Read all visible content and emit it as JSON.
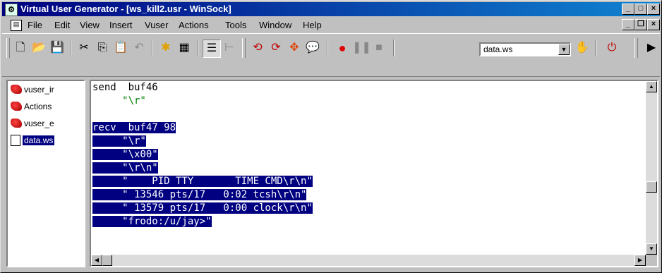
{
  "window": {
    "title": "Virtual User Generator - [ws_kill2.usr - WinSock]"
  },
  "menu": [
    "File",
    "Edit",
    "View",
    "Insert",
    "Vuser",
    "Actions",
    "Tools",
    "Window",
    "Help"
  ],
  "toolbar": {
    "combo_value": "data.ws"
  },
  "tree": [
    {
      "label": "vuser_ir",
      "icon": "red-action-icon"
    },
    {
      "label": "Actions",
      "icon": "red-action-icon"
    },
    {
      "label": "vuser_e",
      "icon": "red-action-icon"
    },
    {
      "label": "data.ws",
      "icon": "data-file-icon",
      "selected": true
    }
  ],
  "editor": {
    "lines": [
      {
        "text": "send  buf46",
        "style": "normal"
      },
      {
        "text": "     \"\\r\"",
        "style": "green"
      },
      {
        "text": "",
        "style": "normal"
      },
      {
        "text": "recv  buf47 98",
        "style": "hl"
      },
      {
        "text": "     \"\\r\"",
        "style": "hl"
      },
      {
        "text": "     \"\\x00\"",
        "style": "hl"
      },
      {
        "text": "     \"\\r\\n\"",
        "style": "hl"
      },
      {
        "text": "     \"    PID TTY       TIME CMD\\r\\n\"",
        "style": "hl"
      },
      {
        "text": "     \" 13546 pts/17   0:02 tcsh\\r\\n\"",
        "style": "hl"
      },
      {
        "text": "     \" 13579 pts/17   0:00 clock\\r\\n\"",
        "style": "hl"
      },
      {
        "text": "     \"frodo:/u/jay>\"",
        "style": "hl"
      }
    ]
  }
}
